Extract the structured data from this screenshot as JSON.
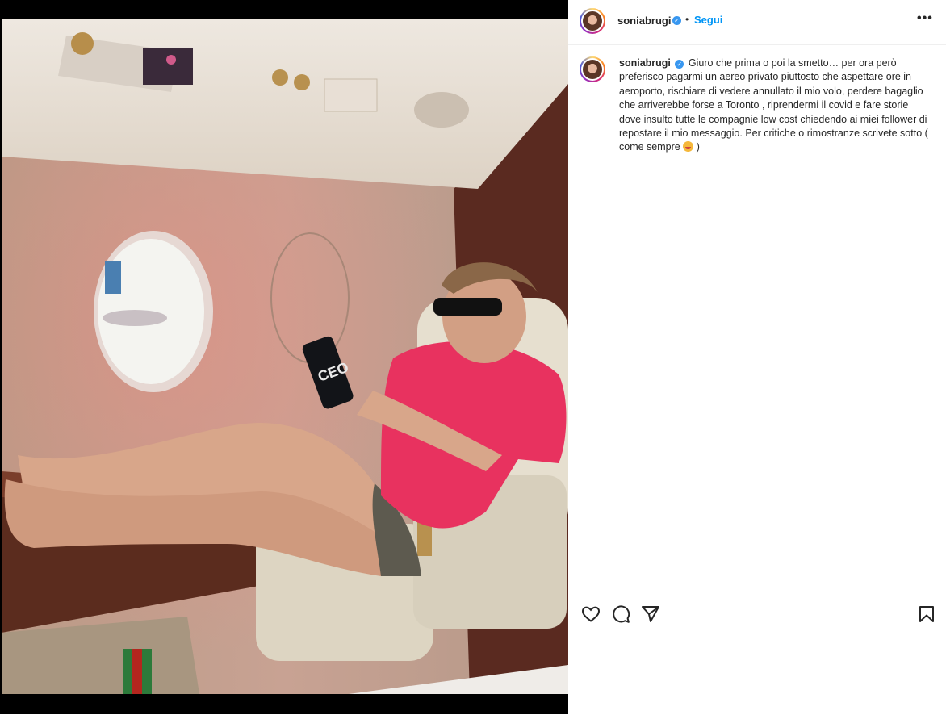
{
  "post": {
    "username": "soniabrugi",
    "follow_label": "Segui",
    "separator": "•",
    "more_label": "•••",
    "caption": "Giuro che prima o poi la smetto… per ora però preferisco pagarmi un aereo privato piuttosto che aspettare ore in aeroporto, rischiare di vedere annullato il mio volo, perdere bagaglio che arriverebbe forse a Toronto , riprendermi il covid e fare storie dove insulto tutte le compagnie low cost chiedendo ai miei follower di repostare il mio messaggio. Per critiche o rimostranze scrivete sotto ( come sempre",
    "caption_end": ")",
    "phone_case_text": "CEO"
  },
  "icons": {
    "verified": "verified-badge-icon",
    "like": "heart-icon",
    "comment": "comment-icon",
    "share": "send-icon",
    "save": "bookmark-icon",
    "emoji": "smiling-face-emoji"
  },
  "colors": {
    "link_blue": "#0095f6",
    "verified_blue": "#3897f0",
    "text": "#262626",
    "shirt_pink": "#e8325f"
  }
}
